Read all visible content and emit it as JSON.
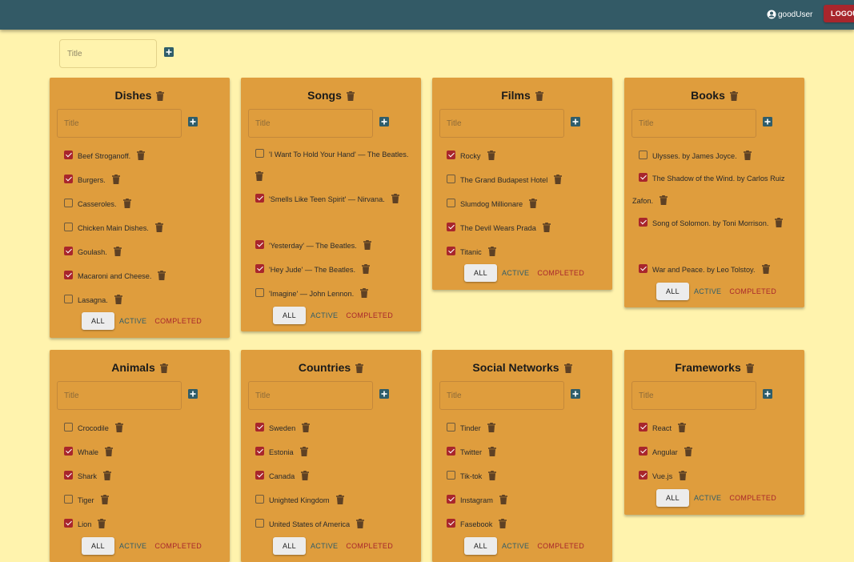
{
  "header": {
    "username": "goodUser",
    "logout_label": "LOGOUT",
    "bg_color": "#335a66",
    "logout_color": "#a8262c"
  },
  "new_list": {
    "placeholder": "Title"
  },
  "filter_labels": {
    "all": "ALL",
    "active": "ACTIVE",
    "completed": "COMPLETED"
  },
  "lists": [
    {
      "title": "Dishes",
      "placeholder": "Title",
      "items": [
        {
          "text": "Beef Stroganoff.",
          "done": true
        },
        {
          "text": "Burgers.",
          "done": true
        },
        {
          "text": "Casseroles.",
          "done": false
        },
        {
          "text": "Chicken Main Dishes.",
          "done": false
        },
        {
          "text": "Goulash.",
          "done": true
        },
        {
          "text": "Macaroni and Cheese.",
          "done": true
        },
        {
          "text": "Lasagna.",
          "done": false
        }
      ]
    },
    {
      "title": "Songs",
      "placeholder": "Title",
      "items": [
        {
          "text": "'I Want To Hold Your Hand' — The Beatles.",
          "done": false
        },
        {
          "text": "'Smells Like Teen Spirit' — Nirvana.",
          "done": true
        },
        {
          "text": "'Yesterday' — The Beatles.",
          "done": true
        },
        {
          "text": "'Hey Jude' — The Beatles.",
          "done": true
        },
        {
          "text": "'Imagine' — John Lennon.",
          "done": false
        }
      ]
    },
    {
      "title": "Films",
      "placeholder": "Title",
      "items": [
        {
          "text": "Rocky",
          "done": true
        },
        {
          "text": "The Grand Budapest Hotel",
          "done": false
        },
        {
          "text": "Slumdog Millionare",
          "done": false
        },
        {
          "text": "The Devil Wears Prada",
          "done": true
        },
        {
          "text": "Titanic",
          "done": true
        }
      ]
    },
    {
      "title": "Books",
      "placeholder": "Title",
      "items": [
        {
          "text": "Ulysses. by James Joyce.",
          "done": false
        },
        {
          "text": "The Shadow of the Wind. by Carlos Ruiz Zafon.",
          "done": true
        },
        {
          "text": "Song of Solomon. by Toni Morrison.",
          "done": true
        },
        {
          "text": "War and Peace. by Leo Tolstoy.",
          "done": true
        }
      ]
    },
    {
      "title": "Animals",
      "placeholder": "Title",
      "items": [
        {
          "text": "Crocodile",
          "done": false
        },
        {
          "text": "Whale",
          "done": true
        },
        {
          "text": "Shark",
          "done": true
        },
        {
          "text": "Tiger",
          "done": false
        },
        {
          "text": "Lion",
          "done": true
        }
      ]
    },
    {
      "title": "Countries",
      "placeholder": "Title",
      "items": [
        {
          "text": "Sweden",
          "done": true
        },
        {
          "text": "Estonia",
          "done": true
        },
        {
          "text": "Canada",
          "done": true
        },
        {
          "text": "Unighted Kingdom",
          "done": false
        },
        {
          "text": "United States of America",
          "done": false
        }
      ]
    },
    {
      "title": "Social Networks",
      "placeholder": "Title",
      "items": [
        {
          "text": "Tinder",
          "done": false
        },
        {
          "text": "Twitter",
          "done": true
        },
        {
          "text": "Tik-tok",
          "done": false
        },
        {
          "text": "Instagram",
          "done": true
        },
        {
          "text": "Fasebook",
          "done": true
        }
      ]
    },
    {
      "title": "Frameworks",
      "placeholder": "Title",
      "items": [
        {
          "text": "React",
          "done": true
        },
        {
          "text": "Angular",
          "done": true
        },
        {
          "text": "Vue.js",
          "done": true
        }
      ]
    }
  ]
}
